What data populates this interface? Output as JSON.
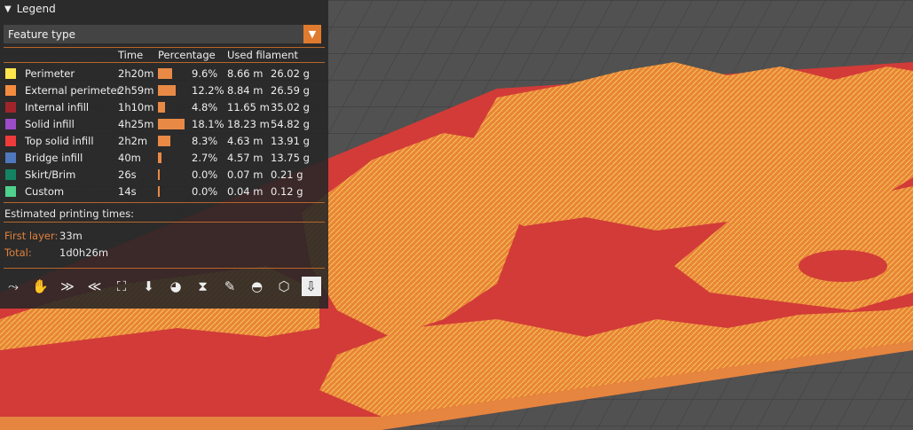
{
  "legend": {
    "title": "Legend",
    "feature_select": "Feature type",
    "columns": {
      "time": "Time",
      "percentage": "Percentage",
      "filament": "Used filament"
    },
    "rows": [
      {
        "name": "Perimeter",
        "color": "#ffe64d",
        "time": "2h20m",
        "pct_text": "9.6%",
        "pct": 9.6,
        "length": "8.66 m",
        "weight": "26.02 g"
      },
      {
        "name": "External perimeter",
        "color": "#f58c3f",
        "time": "2h59m",
        "pct_text": "12.2%",
        "pct": 12.2,
        "length": "8.84 m",
        "weight": "26.59 g"
      },
      {
        "name": "Internal infill",
        "color": "#a0242a",
        "time": "1h10m",
        "pct_text": "4.8%",
        "pct": 4.8,
        "length": "11.65 m",
        "weight": "35.02 g"
      },
      {
        "name": "Solid infill",
        "color": "#9a4cc9",
        "time": "4h25m",
        "pct_text": "18.1%",
        "pct": 18.1,
        "length": "18.23 m",
        "weight": "54.82 g"
      },
      {
        "name": "Top solid infill",
        "color": "#ef3b3b",
        "time": "2h2m",
        "pct_text": "8.3%",
        "pct": 8.3,
        "length": "4.63 m",
        "weight": "13.91 g"
      },
      {
        "name": "Bridge infill",
        "color": "#4f78be",
        "time": "40m",
        "pct_text": "2.7%",
        "pct": 2.7,
        "length": "4.57 m",
        "weight": "13.75 g"
      },
      {
        "name": "Skirt/Brim",
        "color": "#138364",
        "time": "26s",
        "pct_text": "0.0%",
        "pct": 0.0,
        "length": "0.07 m",
        "weight": "0.21 g"
      },
      {
        "name": "Custom",
        "color": "#4fd18e",
        "time": "14s",
        "pct_text": "0.0%",
        "pct": 0.0,
        "length": "0.04 m",
        "weight": "0.12 g"
      }
    ],
    "estimated_label": "Estimated printing times:",
    "first_layer_label": "First layer:",
    "first_layer_value": "33m",
    "total_label": "Total:",
    "total_value": "1d0h26m",
    "toolbar": [
      {
        "icon": "travel-icon",
        "glyph": "⤳"
      },
      {
        "icon": "wipe-icon",
        "glyph": "✋"
      },
      {
        "icon": "retractions-icon",
        "glyph": "≫"
      },
      {
        "icon": "deretractions-icon",
        "glyph": "≪"
      },
      {
        "icon": "seams-icon",
        "glyph": "⛶"
      },
      {
        "icon": "tool-changes-icon",
        "glyph": "⬇"
      },
      {
        "icon": "color-changes-icon",
        "glyph": "◕"
      },
      {
        "icon": "pause-print-icon",
        "glyph": "⧗"
      },
      {
        "icon": "custom-gcode-icon",
        "glyph": "✎"
      },
      {
        "icon": "center-of-gravity-icon",
        "glyph": "◓"
      },
      {
        "icon": "shells-icon",
        "glyph": "⬡"
      },
      {
        "icon": "tool-marker-icon",
        "glyph": "⇩"
      }
    ]
  }
}
